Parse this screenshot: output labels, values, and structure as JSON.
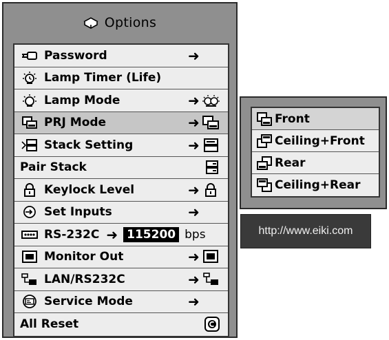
{
  "options": {
    "title": "Options",
    "title_icon": "options-box-icon",
    "items": [
      {
        "label": "Password",
        "icon": "key-icon",
        "arrow": "➜"
      },
      {
        "label": "Lamp Timer (Life)",
        "icon": "lamp-timer-icon"
      },
      {
        "label": "Lamp Mode",
        "icon": "lamp-icon",
        "arrow": "➜"
      },
      {
        "label": "PRJ Mode",
        "icon": "prj-mode-icon",
        "arrow": "➜",
        "selected": true
      },
      {
        "label": "Stack Setting",
        "icon": "stack-icon",
        "arrow": "➜"
      },
      {
        "label": "Pair Stack",
        "icon": "pair-stack-icon"
      },
      {
        "label": "Keylock Level",
        "icon": "lock-icon",
        "arrow": "➜"
      },
      {
        "label": "Set Inputs",
        "icon": "input-icon",
        "arrow": "➜"
      },
      {
        "label": "RS-232C",
        "icon": "rs232c-port-icon",
        "arrow": "➜",
        "value": "115200",
        "unit": "bps"
      },
      {
        "label": "Monitor Out",
        "icon": "monitor-icon",
        "arrow": "➜"
      },
      {
        "label": "LAN/RS232C",
        "icon": "network-icon",
        "arrow": "➜"
      },
      {
        "label": "Service Mode",
        "icon": "service-icon",
        "arrow": "➜"
      },
      {
        "label": "All Reset",
        "icon": "reset-icon"
      }
    ]
  },
  "prj_mode_submenu": {
    "items": [
      {
        "label": "Front",
        "icon": "front-projection-icon",
        "selected": true
      },
      {
        "label": "Ceiling+Front",
        "icon": "ceiling-front-projection-icon"
      },
      {
        "label": "Rear",
        "icon": "rear-projection-icon"
      },
      {
        "label": "Ceiling+Rear",
        "icon": "ceiling-rear-projection-icon"
      }
    ]
  },
  "url": "http://www.eiki.com",
  "colors": {
    "panel": "#8f8f8f",
    "row": "#ededed",
    "selected_row": "#c6c6c6",
    "url_box": "#3a3a3a"
  }
}
